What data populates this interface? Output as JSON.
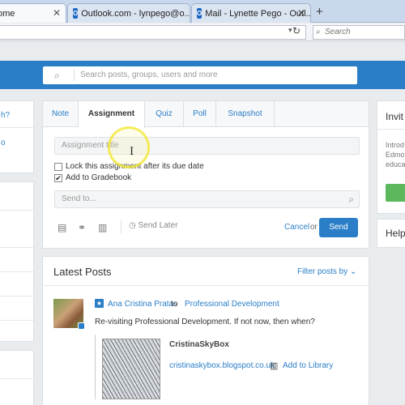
{
  "browser": {
    "tabs": [
      {
        "label": "ome",
        "active": true
      },
      {
        "label": "Outlook.com - lynpego@o...",
        "active": false
      },
      {
        "label": "Mail - Lynette Pego - Outl...",
        "active": false
      }
    ],
    "search_placeholder": "Search"
  },
  "header": {
    "search_placeholder": "Search posts, groups, users and more"
  },
  "left_sidebar": {
    "link1": "h?",
    "link2": "o"
  },
  "composer": {
    "tabs": [
      "Note",
      "Assignment",
      "Quiz",
      "Poll",
      "Snapshot"
    ],
    "active_tab": "Assignment",
    "title_placeholder": "Assignment title",
    "lock_label": "Lock this assignment after its due date",
    "lock_checked": false,
    "gradebook_label": "Add to Gradebook",
    "gradebook_checked": true,
    "check_mark": "✔",
    "sendto_placeholder": "Send to...",
    "send_later": "Send Later",
    "cancel": "Cancel",
    "or": "or",
    "send": "Send"
  },
  "latest_posts": {
    "title": "Latest Posts",
    "filter": "Filter posts by",
    "post": {
      "author": "Ana Cristina Pratas",
      "to": "to",
      "group": "Professional Development",
      "text": "Re-visiting Professional Development. If not now, then when?",
      "link_title": "CristinaSkyBox",
      "link_url": "cristinaskybox.blogspot.co.uk",
      "add_library": "Add to Library"
    }
  },
  "right_sidebar": {
    "invite_title": "Invit",
    "invite_text": [
      "Introd",
      "Edmo",
      "educa"
    ],
    "help_title": "Help"
  },
  "colors": {
    "brand_blue": "#2a7ec7",
    "send_button": "#2a7ec7",
    "green_button": "#5cb85c"
  }
}
